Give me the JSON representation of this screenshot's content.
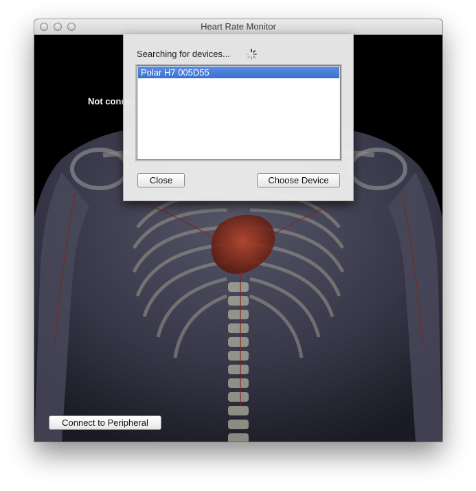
{
  "window": {
    "title": "Heart Rate Monitor"
  },
  "main": {
    "status_text": "Not connected",
    "connect_button_label": "Connect to Peripheral"
  },
  "sheet": {
    "search_label": "Searching for devices...",
    "devices": [
      {
        "name": "Polar H7 005D55",
        "selected": true
      }
    ],
    "close_label": "Close",
    "choose_label": "Choose Device"
  },
  "icons": {
    "spinner": "progress-spinner-icon",
    "traffic_lights": [
      "close-window-icon",
      "minimize-window-icon",
      "zoom-window-icon"
    ]
  },
  "colors": {
    "selection": "#3a70d2",
    "background": "#000000"
  }
}
